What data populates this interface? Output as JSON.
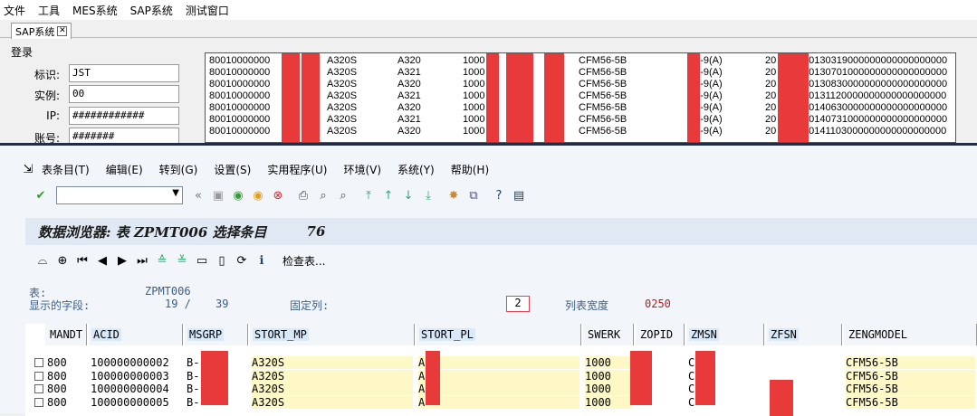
{
  "menubar": [
    "文件",
    "工具",
    "MES系统",
    "SAP系统",
    "测试窗口"
  ],
  "tab": {
    "label": "SAP系统",
    "close": "✕"
  },
  "login": {
    "title": "登录",
    "fields": [
      {
        "label": "标识:",
        "value": "JST"
      },
      {
        "label": "实例:",
        "value": "00"
      },
      {
        "label": "IP:",
        "value": "############"
      },
      {
        "label": "账号:",
        "value": "#######"
      }
    ]
  },
  "top_list": {
    "rows": [
      [
        "80010000000",
        "A320S",
        "A320",
        "1000",
        "CFM56-5B",
        "31-9(A)",
        "20",
        "20130319000000000000000000"
      ],
      [
        "80010000000",
        "A320S",
        "A321",
        "1000",
        "CFM56-5B",
        "31-9(A)",
        "20",
        "20130701000000000000000000"
      ],
      [
        "80010000000",
        "A320S",
        "A320",
        "1000",
        "CFM56-5B",
        "31-9(A)",
        "20",
        "20130830000000000000000000"
      ],
      [
        "80010000000",
        "A320S",
        "A321",
        "1000",
        "CFM56-5B",
        "31-9(A)",
        "20",
        "20131120000000000000000000"
      ],
      [
        "80010000000",
        "A320S",
        "A320",
        "1000",
        "CFM56-5B",
        "31-9(A)",
        "20",
        "20140630000000000000000000"
      ],
      [
        "80010000000",
        "A320S",
        "A321",
        "1000",
        "CFM56-5B",
        "31-9(A)",
        "20",
        "20140731000000000000000000"
      ],
      [
        "80010000000",
        "A320S",
        "A320",
        "1000",
        "CFM56-5B",
        "31-9(A)",
        "20",
        "20141103000000000000000000"
      ]
    ]
  },
  "sap_menu": [
    "表条目(T)",
    "编辑(E)",
    "转到(G)",
    "设置(S)",
    "实用程序(U)",
    "环境(V)",
    "系统(Y)",
    "帮助(H)"
  ],
  "title": {
    "text": "数据浏览器: 表 ZPMT006 选择条目",
    "count": "76"
  },
  "app_toolbar": {
    "check_table": "检查表..."
  },
  "info": {
    "table_label": "表:",
    "table_name": "ZPMT006",
    "shown_label": "显示的字段:",
    "shown_value": "19 /",
    "shown_total": "39",
    "fixed_label": "固定列:",
    "fixed_value": "2",
    "width_label": "列表宽度",
    "width_value": "0250"
  },
  "table": {
    "columns": [
      "MANDT",
      "ACID",
      "MSGRP",
      "STORT_MP",
      "STORT_PL",
      "SWERK",
      "ZOPID",
      "ZMSN",
      "ZFSN",
      "ZENGMODEL"
    ],
    "rows": [
      [
        "800",
        "100000000002",
        "B-",
        "A320S",
        "A",
        "1000",
        "",
        "C",
        "",
        "CFM56-5B"
      ],
      [
        "800",
        "100000000003",
        "B-",
        "A320S",
        "A",
        "1000",
        "",
        "C",
        "",
        "CFM56-5B"
      ],
      [
        "800",
        "100000000004",
        "B-",
        "A320S",
        "A",
        "1000",
        "",
        "C",
        "",
        "CFM56-5B"
      ],
      [
        "800",
        "100000000005",
        "B-",
        "A320S",
        "A",
        "1000",
        "",
        "C",
        "",
        "CFM56-5B"
      ]
    ]
  },
  "colors": {
    "redaction": "#e83a3a",
    "title_bg": "#dfe8f3",
    "dark_border": "#1f2e45",
    "cell_yellow": "#fdf8c6"
  }
}
